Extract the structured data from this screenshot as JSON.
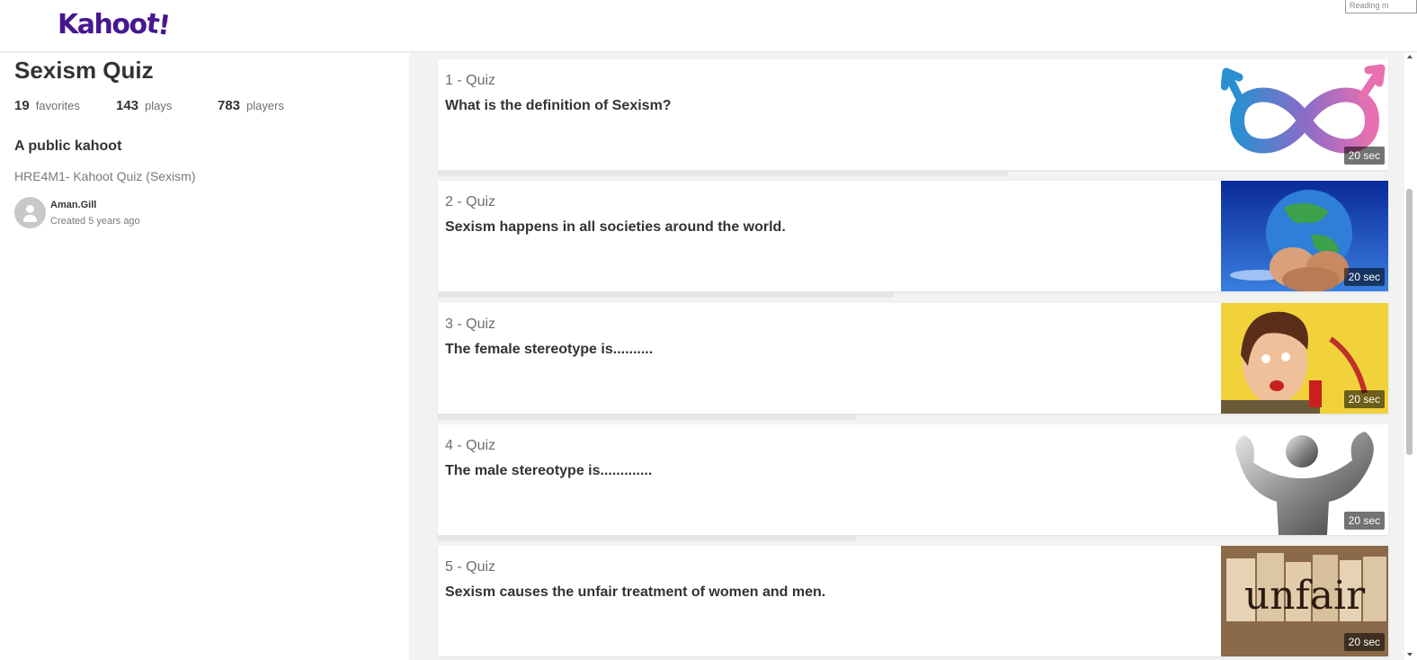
{
  "header": {
    "logo_main": "Kahoo",
    "logo_tail": "t!",
    "logo_color": "#46178f",
    "reading_mode": "Reading m"
  },
  "kahoot": {
    "title": "Sexism Quiz",
    "stats": {
      "favorites_count": "19",
      "favorites_label": "favorites",
      "plays_count": "143",
      "plays_label": "plays",
      "players_count": "783",
      "players_label": "players"
    },
    "visibility": "A public kahoot",
    "description": "HRE4M1- Kahoot Quiz (Sexism)",
    "creator": {
      "name": "Aman.Gill",
      "created": "Created 5 years ago"
    }
  },
  "questions": [
    {
      "type": "1 - Quiz",
      "text": "What is the definition of Sexism?",
      "time": "20 sec",
      "image": "infinity-gender-symbol-image",
      "progress": 0.6
    },
    {
      "type": "2 - Quiz",
      "text": "Sexism happens in all societies around the world.",
      "time": "20 sec",
      "image": "globe-hands-image",
      "progress": 0.48
    },
    {
      "type": "3 - Quiz",
      "text": "The female stereotype is..........",
      "time": "20 sec",
      "image": "vintage-woman-ad-image",
      "progress": 0.44
    },
    {
      "type": "4 - Quiz",
      "text": "The male stereotype is.............",
      "time": "20 sec",
      "image": "metal-muscle-statue-image",
      "progress": 0.44
    },
    {
      "type": "5 - Quiz",
      "text": "Sexism causes the unfair treatment of women and men.",
      "time": "20 sec",
      "image": "unfair-newspaper-letters-image",
      "image_text": "unfair"
    }
  ]
}
